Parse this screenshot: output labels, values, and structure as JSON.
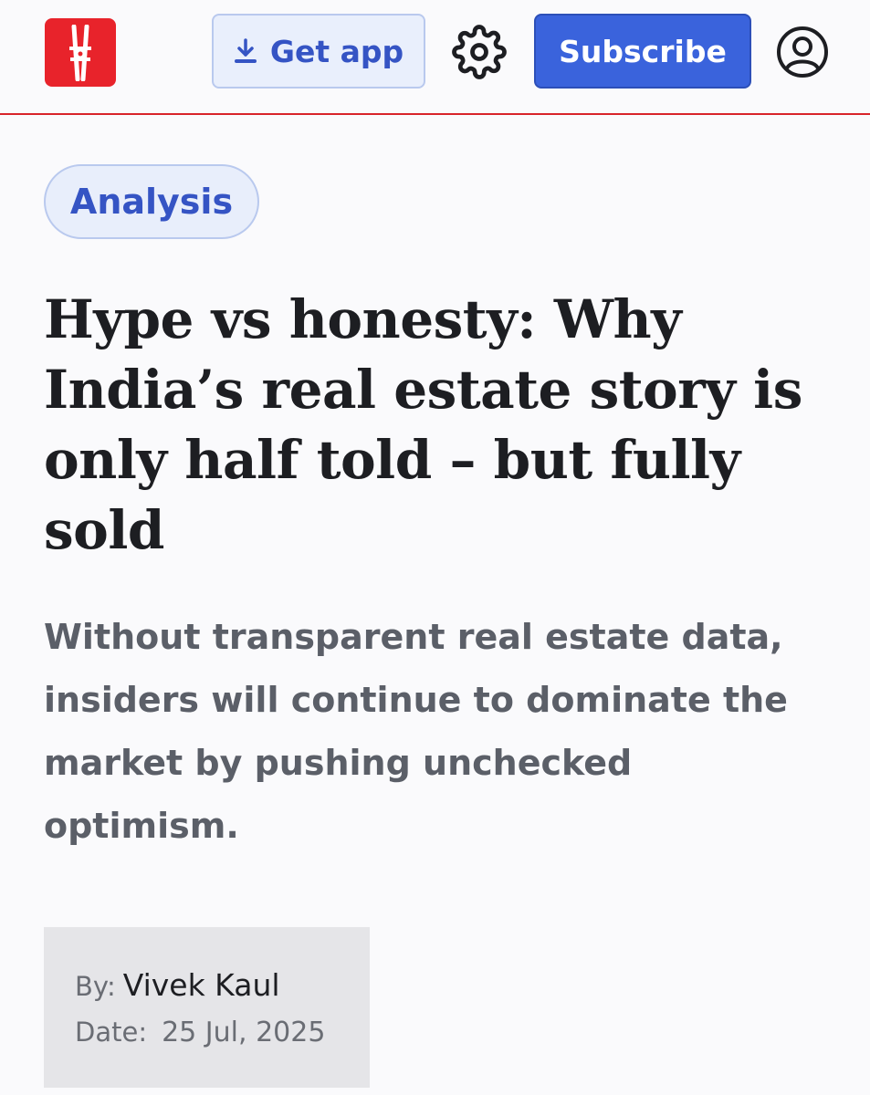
{
  "header": {
    "get_app_label": "Get app",
    "subscribe_label": "Subscribe",
    "icons": {
      "logo": "clothespin-logo-icon",
      "download": "download-icon",
      "settings": "gear-icon",
      "account": "user-account-icon"
    },
    "colors": {
      "brand_red": "#e8232b",
      "accent_blue": "#3a63dc",
      "divider": "#d8232a"
    }
  },
  "article": {
    "tag": "Analysis",
    "headline": "Hype vs honesty: Why India’s real estate story is only half told – but fully sold",
    "standfirst": "Without transparent real estate data, insiders will continue to dominate the market by pushing unchecked optimism.",
    "byline": {
      "by_label": "By:",
      "author": "Vivek Kaul",
      "date_label": "Date:",
      "date": "25 Jul, 2025"
    }
  }
}
